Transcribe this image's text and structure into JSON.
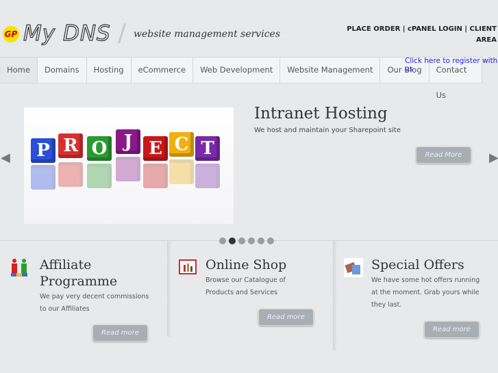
{
  "header": {
    "logo_mark": "GP",
    "logo_text": "My DNS",
    "tagline": "website management services",
    "top_links": [
      "PLACE ORDER",
      "cPANEL LOGIN",
      "CLIENT AREA"
    ],
    "register_link": "Click here to register with us"
  },
  "nav": {
    "tabs": [
      "Home",
      "Domains",
      "Hosting",
      "eCommerce",
      "Web Development",
      "Website Management",
      "Our Blog",
      "Contact Us"
    ]
  },
  "slider": {
    "title": "Intranet Hosting",
    "description": "We host and maintain your Sharepoint site",
    "button": "Read More",
    "image_letters": [
      "P",
      "R",
      "O",
      "J",
      "E",
      "C",
      "T"
    ],
    "dots": 6,
    "active_dot": 2
  },
  "columns": [
    {
      "title": "Affiliate Programme",
      "description": "We pay very decent commissions to our Affiliates",
      "button": "Read more"
    },
    {
      "title": "Online Shop",
      "description": "Browse our Catalogue of Products and Services",
      "button": "Read more"
    },
    {
      "title": "Special Offers",
      "description": "We have some hot offers running at the moment. Grab yours while they last.",
      "button": "Read more"
    }
  ]
}
